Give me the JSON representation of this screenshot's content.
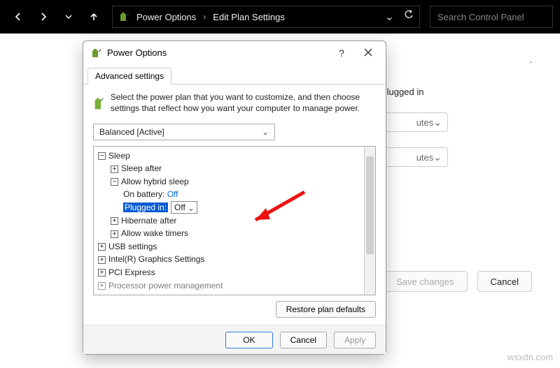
{
  "topbar": {
    "breadcrumb": {
      "root": "Power Options",
      "leaf": "Edit Plan Settings"
    },
    "search_placeholder": "Search Control Panel"
  },
  "page": {
    "plugged_in_label": "Plugged in",
    "select_suffix": "utes",
    "save_label": "Save changes",
    "cancel_label": "Cancel"
  },
  "dialog": {
    "title": "Power Options",
    "tab": "Advanced settings",
    "intro": "Select the power plan that you want to customize, and then choose settings that reflect how you want your computer to manage power.",
    "plan": "Balanced [Active]",
    "tree": {
      "sleep": "Sleep",
      "sleep_after": "Sleep after",
      "allow_hybrid": "Allow hybrid sleep",
      "on_battery_label": "On battery:",
      "on_battery_value": "Off",
      "plugged_in_label": "Plugged in:",
      "plugged_in_value": "Off",
      "hibernate_after": "Hibernate after",
      "allow_wake": "Allow wake timers",
      "usb": "USB settings",
      "intel": "Intel(R) Graphics Settings",
      "pci": "PCI Express",
      "proc": "Processor power management"
    },
    "restore_label": "Restore plan defaults",
    "ok_label": "OK",
    "cancel_label": "Cancel",
    "apply_label": "Apply"
  },
  "watermark": "wsxdn.com"
}
